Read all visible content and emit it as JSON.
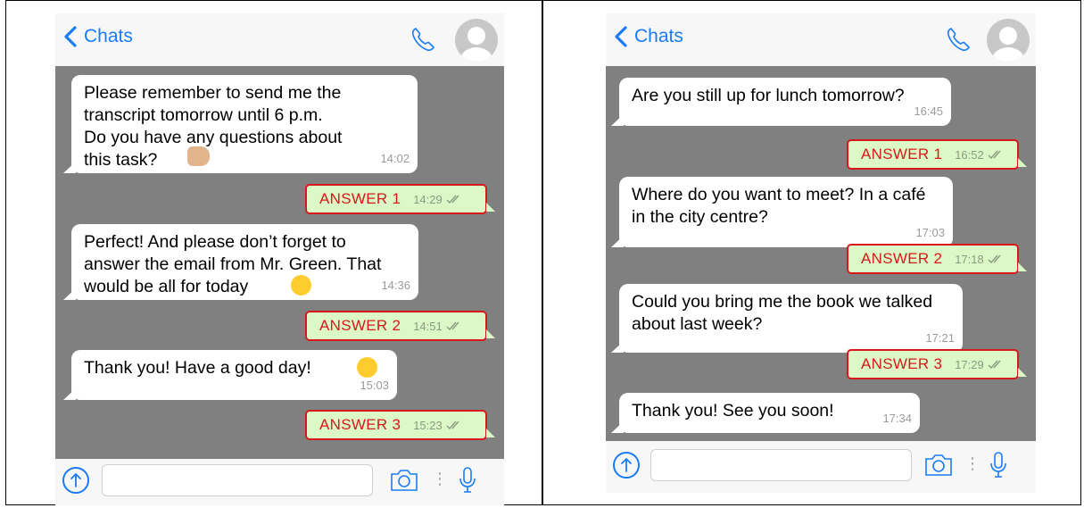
{
  "left": {
    "header": {
      "back_label": "Chats"
    },
    "messages": [
      {
        "text": "Please remember to send me the\ntranscript tomorrow until 6 p.m.\nDo you have any questions about\nthis task?",
        "time": "14:02",
        "emoji": "thumbs-up"
      },
      {
        "answer": "ANSWER 1",
        "time": "14:29"
      },
      {
        "text": "Perfect! And please don’t forget to\nanswer the email from Mr. Green. That\nwould be all for today",
        "time": "14:36",
        "emoji": "winking-face"
      },
      {
        "answer": "ANSWER 2",
        "time": "14:51"
      },
      {
        "text": "Thank you! Have a good day!",
        "time": "15:03",
        "emoji": "smiling-face"
      },
      {
        "answer": "ANSWER 3",
        "time": "15:23"
      }
    ]
  },
  "right": {
    "header": {
      "back_label": "Chats"
    },
    "messages": [
      {
        "text": "Are you still up for lunch tomorrow?",
        "time": "16:45"
      },
      {
        "answer": "ANSWER 1",
        "time": "16:52"
      },
      {
        "text": "Where do you want to meet? In a café\nin the city centre?",
        "time": "17:03"
      },
      {
        "answer": "ANSWER 2",
        "time": "17:18"
      },
      {
        "text": "Could you bring me the book we talked\nabout last week?",
        "time": "17:21"
      },
      {
        "answer": "ANSWER 3",
        "time": "17:29"
      },
      {
        "text": "Thank you! See you soon!",
        "time": "17:34"
      }
    ]
  },
  "colors": {
    "accent": "#1a7cf4",
    "chat_bg": "#808080",
    "answer_border": "#d7191c",
    "answer_bg": "#dcf8c6"
  },
  "icons": [
    "back-chevron-icon",
    "phone-icon",
    "avatar-icon",
    "upload-icon",
    "camera-icon",
    "microphone-icon",
    "double-check-icon"
  ]
}
